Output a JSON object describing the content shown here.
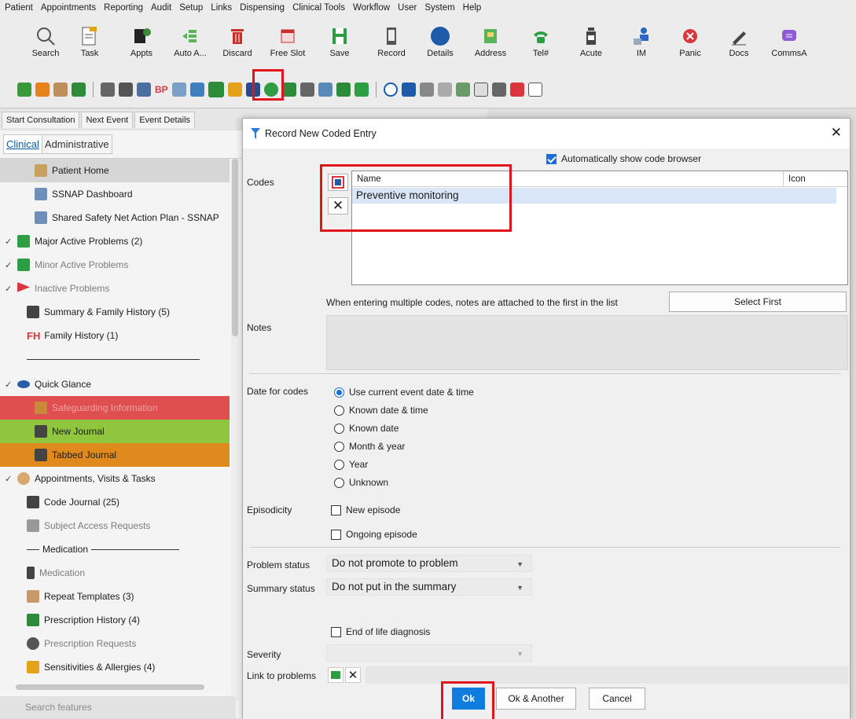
{
  "menubar": [
    "Patient",
    "Appointments",
    "Reporting",
    "Audit",
    "Setup",
    "Links",
    "Dispensing",
    "Clinical Tools",
    "Workflow",
    "User",
    "System",
    "Help"
  ],
  "toolbar": {
    "buttons": [
      "Search",
      "Task",
      "Appts",
      "Auto A...",
      "Discard",
      "Free Slot",
      "Save",
      "Record",
      "Details",
      "Address",
      "Tel#",
      "Acute",
      "IM",
      "Panic",
      "Docs",
      "CommsA"
    ],
    "bp_label": "BP",
    "colors": {
      "highlight": "#e0151c"
    }
  },
  "tabs": [
    "Start Consultation",
    "Next Event",
    "Event Details"
  ],
  "left": {
    "tab_clinical": "Clinical",
    "tab_administrative": "Administrative",
    "items": [
      "Patient Home",
      "SSNAP Dashboard",
      "Shared Safety Net Action Plan - SSNAP",
      "Major Active Problems (2)",
      "Minor Active Problems",
      "Inactive Problems",
      "Summary & Family History (5)",
      "Family History (1)",
      "Quick Glance",
      "Safeguarding Information",
      "New Journal",
      "Tabbed Journal",
      "Appointments, Visits & Tasks",
      "Code Journal (25)",
      "Subject Access Requests",
      "Medication",
      "Medication",
      "Repeat Templates (3)",
      "Prescription History (4)",
      "Prescription Requests",
      "Sensitivities & Allergies (4)"
    ],
    "fh_abbrev": "FH",
    "search_placeholder": "Search features"
  },
  "dialog": {
    "title": "Record New Coded Entry",
    "auto_show_label": "Automatically show code browser",
    "codes_label": "Codes",
    "col_name": "Name",
    "col_icon": "Icon",
    "code_rows": [
      "Preventive monitoring"
    ],
    "multi_note": "When entering multiple codes, notes are attached to the first in the list",
    "select_first": "Select First",
    "notes_label": "Notes",
    "date_label": "Date for codes",
    "date_options": [
      "Use current event date & time",
      "Known date & time",
      "Known date",
      "Month & year",
      "Year",
      "Unknown"
    ],
    "episodicity_label": "Episodicity",
    "new_episode": "New episode",
    "ongoing_episode": "Ongoing episode",
    "problem_status_label": "Problem status",
    "problem_status_value": "Do not promote to problem",
    "summary_status_label": "Summary status",
    "summary_status_value": "Do not put in the summary",
    "end_of_life": "End of life diagnosis",
    "severity_label": "Severity",
    "link_label": "Link to problems",
    "ok": "Ok",
    "ok_another": "Ok & Another",
    "cancel": "Cancel"
  }
}
